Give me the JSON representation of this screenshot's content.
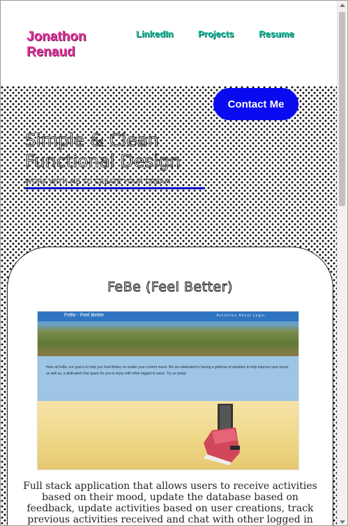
{
  "header": {
    "brand_line1": "Jonathon",
    "brand_line2": "Renaud",
    "nav": [
      {
        "label": "LinkedIn"
      },
      {
        "label": "Projects"
      },
      {
        "label": "Resume"
      }
    ]
  },
  "hero": {
    "contact_label": "Contact Me",
    "title_line1": "Simple & Clean",
    "title_line2": "Functional Design",
    "subtitle": "WORK WITH ME TO CREATE YOUR DREAM"
  },
  "project": {
    "title": "FeBe (Feel Better)",
    "screenshot": {
      "brand": "FeBe - Feel Better",
      "links": "Activities   About   Login",
      "text": "Here at FeBe, our goal is to help you Feel Better, no matter your current mood. We are dedicated to having a plethora of activities to help improve your mood, as well as, a dedicated chat space for you to enjoy with other logged in users. Try us today!"
    },
    "description": "Full stack application that allows users to receive activities based on their mood, update the database based on feedback, update activities based on user creations, track previous activities received and chat with other logged in users."
  },
  "colors": {
    "brand": "#e0309a",
    "nav": "#19c3a4",
    "button": "#0a0af0",
    "underline": "#1010d0"
  }
}
